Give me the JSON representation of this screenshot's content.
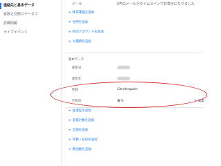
{
  "sidebar": {
    "items": [
      {
        "label": "連絡先と基本データ",
        "active": true
      },
      {
        "label": "家族と交際ステータス",
        "active": false
      },
      {
        "label": "詳細情報",
        "active": false
      },
      {
        "label": "ライフイベント",
        "active": false
      }
    ]
  },
  "contact": {
    "email_label": "メール",
    "email_note": "2件のメールがタイムラインで非表示になりました",
    "add_links": [
      "携帯電話を追加",
      "住所を追加",
      "他のアカウントを追加",
      "公開鍵を追加"
    ]
  },
  "basic": {
    "section_title": "基本データ",
    "birthday_label": "誕生日",
    "birth_year_label": "誕生年",
    "gender_label": "性別",
    "gender_value": "Genderqueer",
    "pronoun_label": "代名詞",
    "pronoun_value": "彼ら",
    "edit_label": "編集",
    "add_links": [
      "血液型を追加",
      "恋愛対象を追加",
      "言語を追加",
      "宗教・信仰を追加",
      "政治観を追加"
    ]
  },
  "colors": {
    "link": "#1877f2",
    "highlight_oval": "#d92b2b"
  }
}
